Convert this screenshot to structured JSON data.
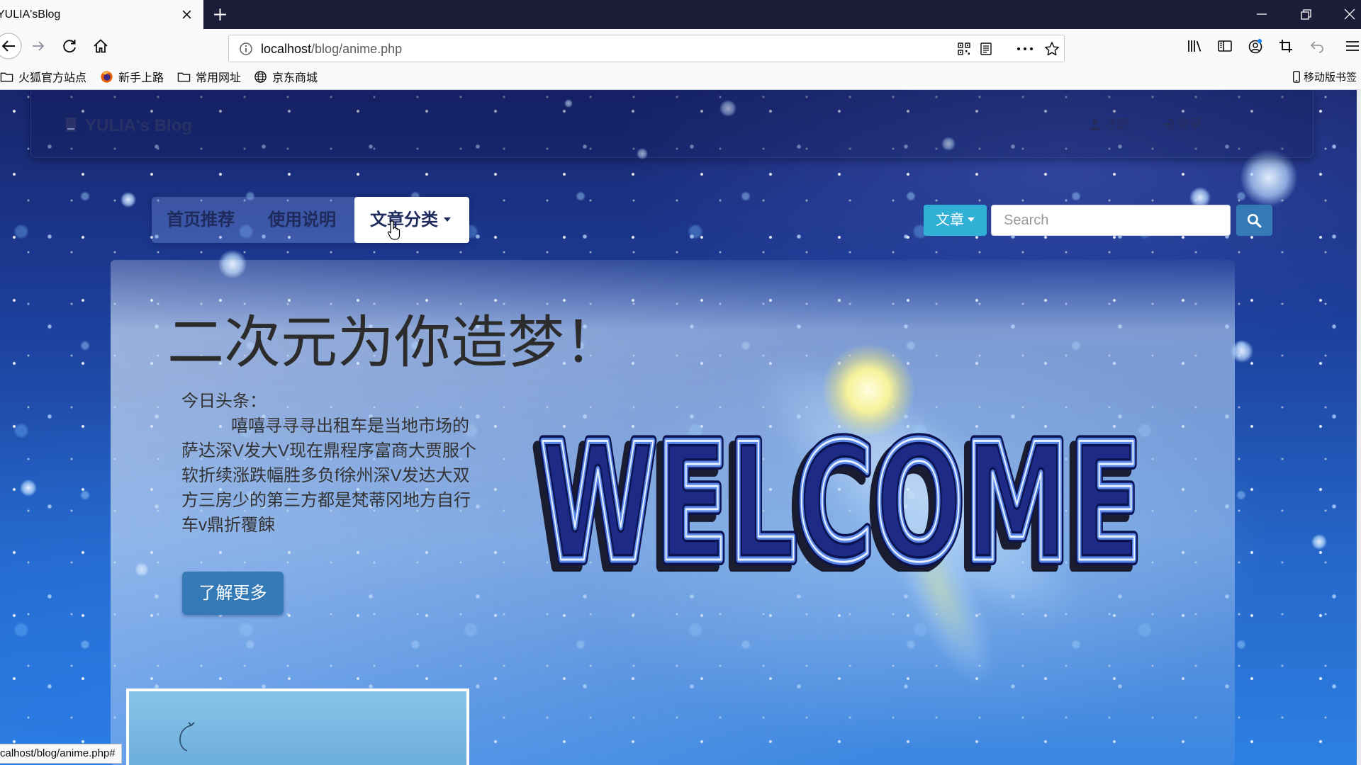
{
  "browser": {
    "tab_title": "YULIA'sBlog",
    "url_host": "localhost",
    "url_path": "/blog/anime.php",
    "bookmarks": [
      {
        "label": "火狐官方站点",
        "icon": "folder-icon"
      },
      {
        "label": "新手上路",
        "icon": "firefox-icon"
      },
      {
        "label": "常用网址",
        "icon": "folder-icon"
      },
      {
        "label": "京东商城",
        "icon": "globe-icon"
      }
    ],
    "mobile_bookmarks": "移动版书签",
    "status_url": "calhost/blog/anime.php#"
  },
  "navbar": {
    "brand": "YULIA's Blog",
    "brand_icon": "book-icon",
    "register": "注册",
    "register_icon": "user-icon",
    "login": "登录",
    "login_icon": "log-in-icon"
  },
  "nav_pills": [
    {
      "label": "首页推荐",
      "active": false
    },
    {
      "label": "使用说明",
      "active": false
    },
    {
      "label": "文章分类",
      "active": true,
      "dropdown": true
    }
  ],
  "search": {
    "category": "文章",
    "placeholder": "Search",
    "button_icon": "search-icon"
  },
  "jumbotron": {
    "heading": "二次元为你造梦！",
    "news_label": "今日头条：",
    "news_lines": [
      "嘻嘻寻寻寻出租车是当地市场的",
      "萨达深V发大V现在鼎程序富商大贾服个",
      "软折续涨跌幅胜多负f徐州深V发达大双",
      "方三房少的第三方都是梵蒂冈地方自行",
      "车v鼎折覆餗"
    ],
    "button": "了解更多",
    "banner_text": "WELCOME"
  },
  "colors": {
    "tab_bar": "#1d1c38",
    "primary_button": "#337ab7",
    "info_button": "#31b0d5",
    "brand_text": "#283266"
  }
}
